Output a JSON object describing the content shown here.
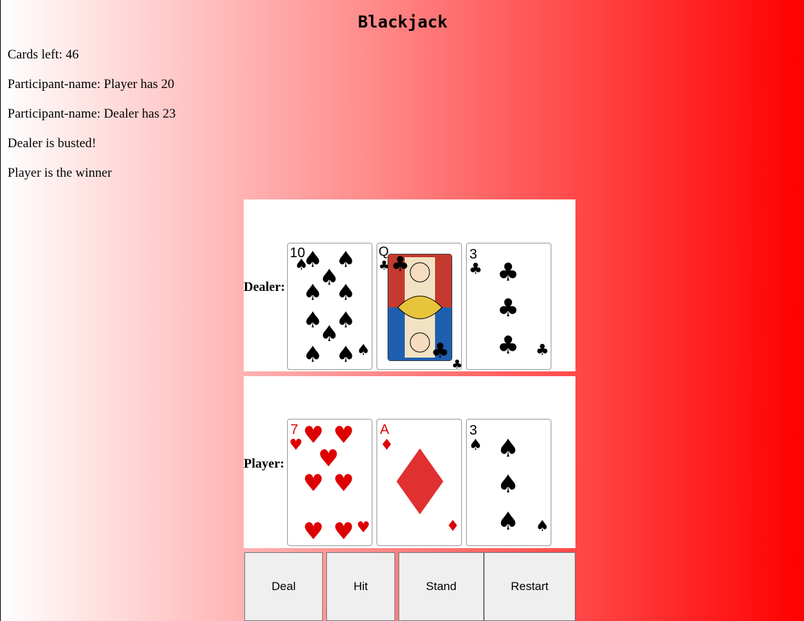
{
  "title": "Blackjack",
  "status": {
    "cards_left": "Cards left: 46",
    "player_line": "Participant-name: Player has 20",
    "dealer_line": "Participant-name: Dealer has 23",
    "bust_message": "Dealer is busted!",
    "winner_message": "Player is the winner"
  },
  "dealer": {
    "label": "Dealer:",
    "cards": [
      {
        "rank": "10",
        "suit": "spades",
        "color": "#000000"
      },
      {
        "rank": "Q",
        "suit": "clubs",
        "color": "#000000"
      },
      {
        "rank": "3",
        "suit": "clubs",
        "color": "#000000"
      }
    ]
  },
  "player": {
    "label": "Player:",
    "cards": [
      {
        "rank": "7",
        "suit": "hearts",
        "color": "#dd0000"
      },
      {
        "rank": "A",
        "suit": "diamonds",
        "color": "#dd0000"
      },
      {
        "rank": "3",
        "suit": "spades",
        "color": "#000000"
      }
    ]
  },
  "buttons": {
    "deal": "Deal",
    "hit": "Hit",
    "stand": "Stand",
    "restart": "Restart"
  }
}
